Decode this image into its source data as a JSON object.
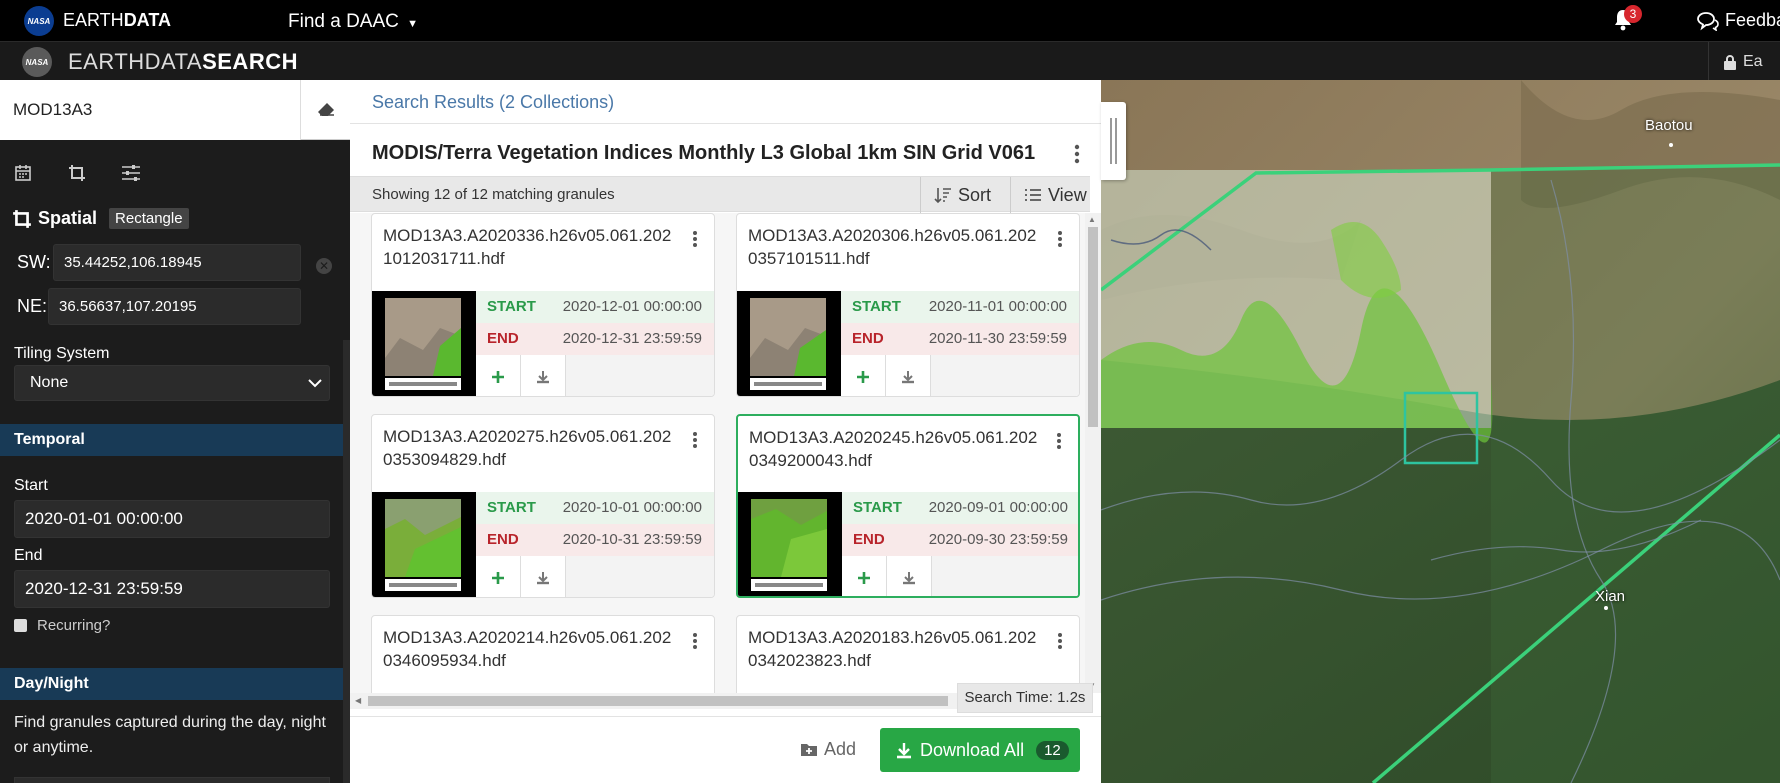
{
  "topbar": {
    "nasa_badge": "NASA",
    "brand_prefix": "EARTH",
    "brand_bold": "DATA",
    "find_daac": "Find a DAAC",
    "notification_count": "3",
    "feedback": "Feedba"
  },
  "subbar": {
    "nasa_badge": "NASA",
    "app_prefix": "EARTHDATA",
    "app_bold": "SEARCH",
    "login_partial": "Ea"
  },
  "left": {
    "keyword": "MOD13A3",
    "spatial": {
      "title": "Spatial",
      "type": "Rectangle",
      "sw_label": "SW:",
      "sw_value": "35.44252,106.18945",
      "ne_label": "NE:",
      "ne_value": "36.56637,107.20195"
    },
    "tiling": {
      "label": "Tiling System",
      "value": "None"
    },
    "temporal": {
      "header": "Temporal",
      "start_label": "Start",
      "start_value": "2020-01-01 00:00:00",
      "end_label": "End",
      "end_value": "2020-12-31 23:59:59",
      "recurring": "Recurring?"
    },
    "daynight": {
      "header": "Day/Night",
      "description": "Find granules captured during the day, night or anytime."
    }
  },
  "results": {
    "heading": "Search Results (2 Collections)",
    "collection_title": "MODIS/Terra Vegetation Indices Monthly L3 Global 1km SIN Grid V061",
    "showing": "Showing 12 of 12 matching granules",
    "sort_label": "Sort",
    "view_label": "View",
    "search_time": "Search Time: 1.2s",
    "add_label": "Add",
    "download_label": "Download All",
    "download_count": "12",
    "granules": [
      {
        "name": "MOD13A3.A2020336.h26v05.061.2021012031711.hdf",
        "start_label": "START",
        "start": "2020-12-01 00:00:00",
        "end_label": "END",
        "end": "2020-12-31 23:59:59"
      },
      {
        "name": "MOD13A3.A2020306.h26v05.061.2020357101511.hdf",
        "start_label": "START",
        "start": "2020-11-01 00:00:00",
        "end_label": "END",
        "end": "2020-11-30 23:59:59"
      },
      {
        "name": "MOD13A3.A2020275.h26v05.061.2020353094829.hdf",
        "start_label": "START",
        "start": "2020-10-01 00:00:00",
        "end_label": "END",
        "end": "2020-10-31 23:59:59"
      },
      {
        "name": "MOD13A3.A2020245.h26v05.061.2020349200043.hdf",
        "start_label": "START",
        "start": "2020-09-01 00:00:00",
        "end_label": "END",
        "end": "2020-09-30 23:59:59"
      },
      {
        "name": "MOD13A3.A2020214.h26v05.061.2020346095934.hdf"
      },
      {
        "name": "MOD13A3.A2020183.h26v05.061.2020342023823.hdf"
      }
    ]
  },
  "map": {
    "labels": {
      "baotou": "Baotou",
      "xian": "Xian"
    }
  },
  "colors": {
    "accent": "#28a745",
    "section": "#183a56",
    "link": "#4a78a8",
    "selected": "#2dae5e"
  }
}
